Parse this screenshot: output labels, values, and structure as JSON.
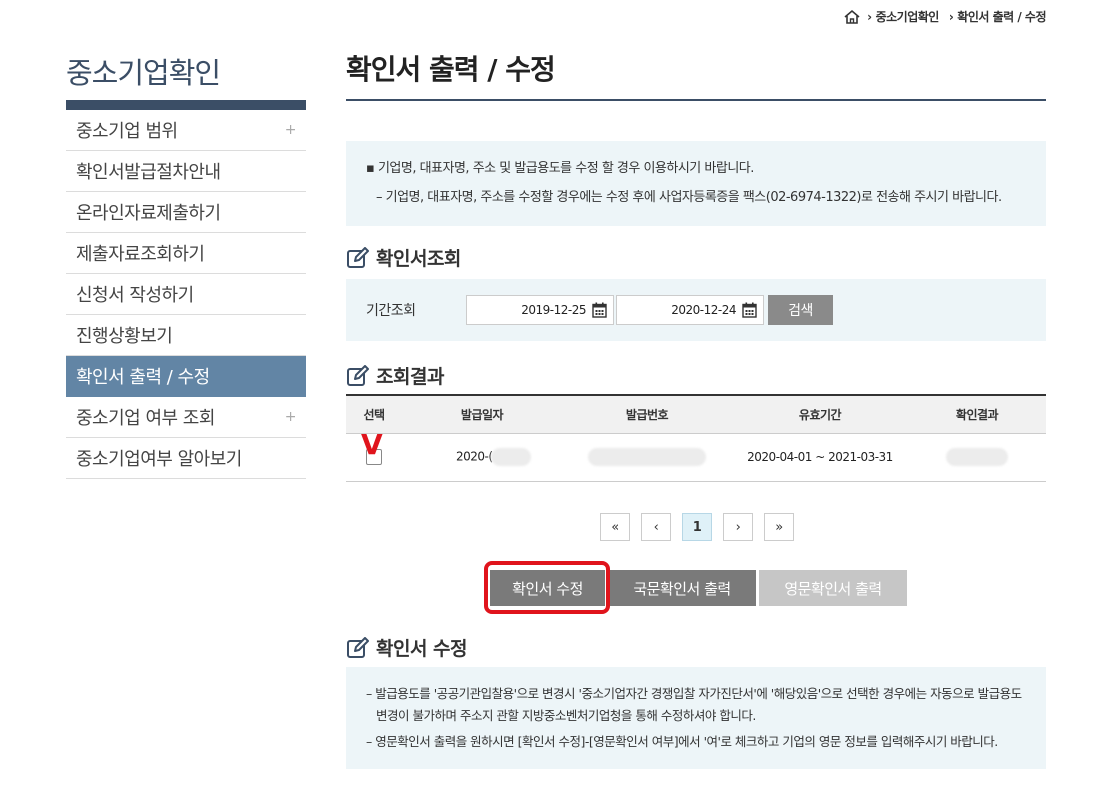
{
  "breadcrumb": {
    "items": [
      "중소기업확인",
      "확인서 출력 / 수정"
    ]
  },
  "sidebar": {
    "title": "중소기업확인",
    "items": [
      {
        "label": "중소기업 범위",
        "expandable": true
      },
      {
        "label": "확인서발급절차안내",
        "expandable": false
      },
      {
        "label": "온라인자료제출하기",
        "expandable": false
      },
      {
        "label": "제출자료조회하기",
        "expandable": false
      },
      {
        "label": "신청서 작성하기",
        "expandable": false
      },
      {
        "label": "진행상황보기",
        "expandable": false
      },
      {
        "label": "확인서 출력 / 수정",
        "expandable": false,
        "active": true
      },
      {
        "label": "중소기업 여부 조회",
        "expandable": true
      },
      {
        "label": "중소기업여부 알아보기",
        "expandable": false
      }
    ],
    "plus_glyph": "+"
  },
  "main": {
    "title": "확인서 출력 / 수정",
    "notice": [
      "▪ 기업명, 대표자명, 주소 및 발급용도를 수정 할 경우 이용하시기 바랍니다.",
      "– 기업명, 대표자명, 주소를 수정할 경우에는 수정 후에 사업자등록증을 팩스(02-6974-1322)로 전송해 주시기 바랍니다."
    ],
    "search_section": {
      "heading": "확인서조회",
      "label": "기간조회",
      "start_date": "2019-12-25",
      "end_date": "2020-12-24",
      "search_button": "검색"
    },
    "results_section": {
      "heading": "조회결과",
      "columns": [
        "선택",
        "발급일자",
        "발급번호",
        "유효기간",
        "확인결과"
      ],
      "rows": [
        {
          "issue_date": "2020-(",
          "issue_no": "",
          "valid_period": "2020-04-01 ~ 2021-03-31",
          "result": ""
        }
      ],
      "annotation_mark": "V"
    },
    "pagination": {
      "first": "«",
      "prev": "‹",
      "current": "1",
      "next": "›",
      "last": "»"
    },
    "actions": {
      "edit": "확인서 수정",
      "print_korean": "국문확인서 출력",
      "print_english": "영문확인서 출력"
    },
    "edit_section": {
      "heading": "확인서 수정",
      "notes": [
        "– 발급용도를 '공공기관입찰용'으로 변경시 '중소기업자간 경쟁입찰 자가진단서'에 '해당있음'으로 선택한 경우에는 자동으로 발급용도 변경이 불가하며 주소지 관할 지방중소벤처기업청을 통해 수정하셔야 합니다.",
        "– 영문확인서 출력을 원하시면 [확인서 수정]-[영문확인서 여부]에서 '여'로 체크하고 기업의 영문 정보를 입력해주시기 바랍니다."
      ]
    }
  },
  "colors": {
    "navy": "#3b4e66",
    "active_menu": "#6285a5",
    "info_bg": "#edf5f8",
    "button_gray": "#7a7a7a",
    "button_disabled": "#c6c6c6",
    "highlight_red": "#e0141c"
  }
}
